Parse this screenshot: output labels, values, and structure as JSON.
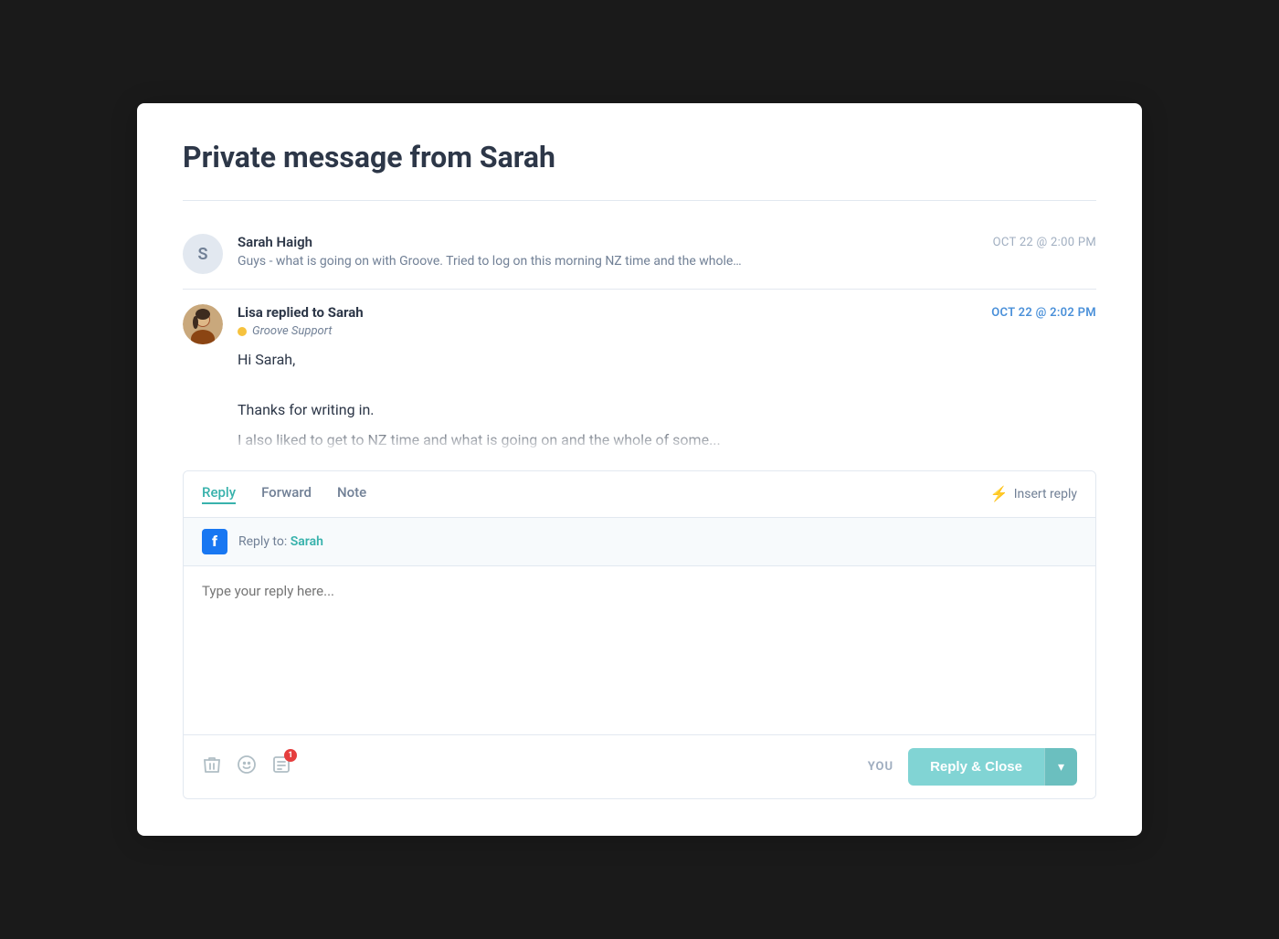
{
  "modal": {
    "title": "Private message from Sarah"
  },
  "messages": [
    {
      "id": "msg-1",
      "sender": "Sarah Haigh",
      "avatar_letter": "S",
      "timestamp": "OCT 22 @ 2:00 PM",
      "timestamp_style": "normal",
      "preview": "Guys - what is going on with Groove. Tried to log on this morning NZ time and the whole…",
      "is_reply": false
    },
    {
      "id": "msg-2",
      "sender": "Lisa replied to Sarah",
      "has_photo": true,
      "timestamp": "OCT 22 @ 2:02 PM",
      "timestamp_style": "blue",
      "channel": "Groove Support",
      "body_line1": "Hi Sarah,",
      "body_line2": "Thanks for writing in.",
      "body_truncated": "I also liked to get to NZ time and what is going on and the whole of some...",
      "is_reply": true
    }
  ],
  "reply_box": {
    "tabs": [
      "Reply",
      "Forward",
      "Note"
    ],
    "active_tab": "Reply",
    "insert_reply_label": "Insert reply",
    "reply_to_label": "Reply to:",
    "reply_to_name": "Sarah",
    "textarea_placeholder": "Type your reply here...",
    "you_label": "YOU",
    "submit_button": "Reply & Close"
  },
  "icons": {
    "lightning": "⚡",
    "trash": "🗑",
    "emoji": "😊",
    "canned": "📋",
    "chevron_down": "▾",
    "facebook_f": "f"
  }
}
